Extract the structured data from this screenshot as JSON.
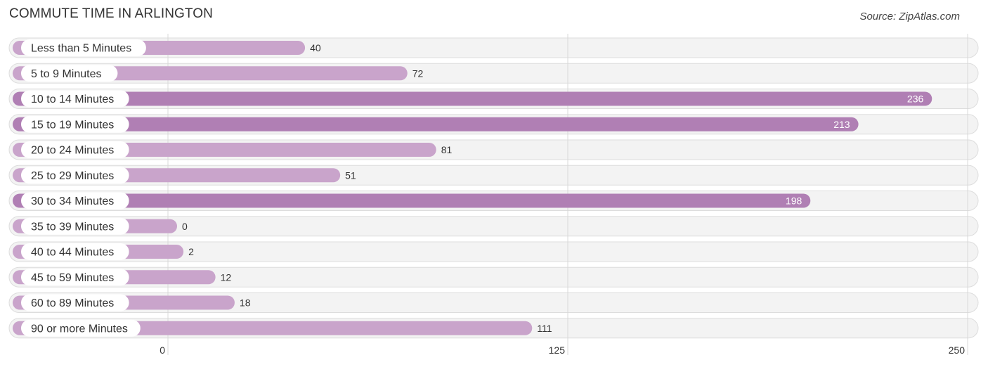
{
  "header": {
    "title": "COMMUTE TIME IN ARLINGTON",
    "source": "Source: ZipAtlas.com"
  },
  "colors": {
    "bar_dark": "#b07fb4",
    "bar_light": "#c9a4cb",
    "row_bg": "#f3f3f3"
  },
  "chart_data": {
    "type": "bar",
    "orientation": "horizontal",
    "title": "COMMUTE TIME IN ARLINGTON",
    "xlabel": "",
    "ylabel": "",
    "xlim": [
      0,
      250
    ],
    "xticks": [
      0,
      125,
      250
    ],
    "xtick_labels": [
      "0",
      "125",
      "250"
    ],
    "grid": true,
    "categories": [
      "Less than 5 Minutes",
      "5 to 9 Minutes",
      "10 to 14 Minutes",
      "15 to 19 Minutes",
      "20 to 24 Minutes",
      "25 to 29 Minutes",
      "30 to 34 Minutes",
      "35 to 39 Minutes",
      "40 to 44 Minutes",
      "45 to 59 Minutes",
      "60 to 89 Minutes",
      "90 or more Minutes"
    ],
    "values": [
      40,
      72,
      236,
      213,
      81,
      51,
      198,
      0,
      2,
      12,
      18,
      111
    ],
    "value_labels": [
      "40",
      "72",
      "236",
      "213",
      "81",
      "51",
      "198",
      "0",
      "2",
      "12",
      "18",
      "111"
    ]
  }
}
